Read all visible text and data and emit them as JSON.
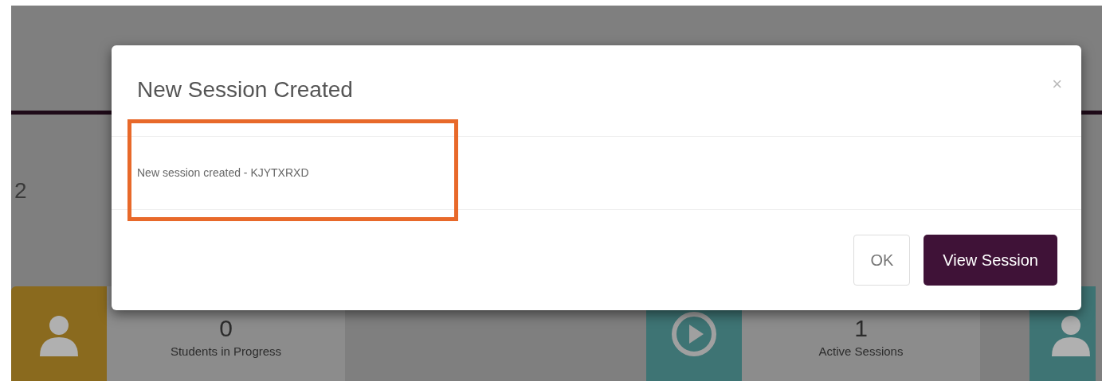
{
  "page": {
    "count": "2",
    "stats": [
      {
        "kind": "person",
        "color": "#8a6a1e",
        "value": "0",
        "label": "Students in Progress"
      },
      {
        "kind": "play",
        "color": "#3e7474",
        "value": "1",
        "label": "Active Sessions"
      },
      {
        "kind": "person",
        "color": "#3e7474"
      }
    ]
  },
  "modal": {
    "title": "New Session Created",
    "close": "×",
    "message": {
      "text": "New session created - KJYTXRXD",
      "highlighted": true
    },
    "buttons": [
      {
        "label": "OK",
        "primary": false
      },
      {
        "label": "View Session",
        "primary": true
      }
    ]
  }
}
